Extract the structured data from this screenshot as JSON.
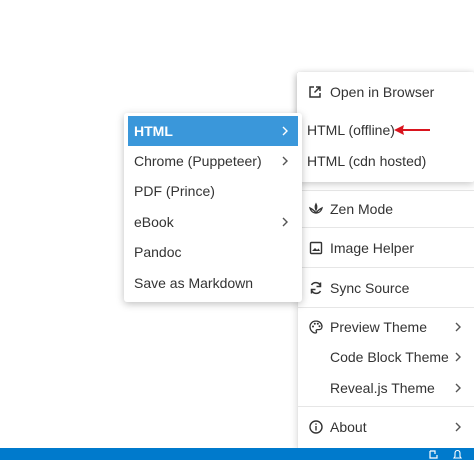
{
  "main_menu": {
    "items": [
      {
        "label": "Zen Mode",
        "icon": "zen-mode-icon"
      },
      {
        "label": "Image Helper",
        "icon": "image-icon"
      },
      {
        "label": "Sync Source",
        "icon": "sync-icon"
      },
      {
        "label": "Preview Theme",
        "icon": "palette-icon",
        "has_submenu": true
      },
      {
        "label": "Code Block Theme",
        "has_submenu": true
      },
      {
        "label": "Reveal.js Theme",
        "has_submenu": true
      },
      {
        "label": "About",
        "icon": "info-icon",
        "has_submenu": true
      }
    ]
  },
  "export_submenu": {
    "items": [
      {
        "label": "Open in Browser",
        "icon": "open-external-icon"
      },
      {
        "label": "HTML (offline)"
      },
      {
        "label": "HTML (cdn hosted)"
      }
    ],
    "annotation_color": "#d9141e"
  },
  "html_submenu": {
    "items": [
      {
        "label": "HTML",
        "active": true,
        "has_submenu": true
      },
      {
        "label": "Chrome (Puppeteer)",
        "has_submenu": true
      },
      {
        "label": "PDF (Prince)"
      },
      {
        "label": "eBook",
        "has_submenu": true
      },
      {
        "label": "Pandoc"
      },
      {
        "label": "Save as Markdown"
      }
    ],
    "active_color": "#3a97da"
  },
  "status_bar": {
    "color": "#007acc",
    "icons": [
      "remote-icon",
      "bell-icon"
    ]
  }
}
